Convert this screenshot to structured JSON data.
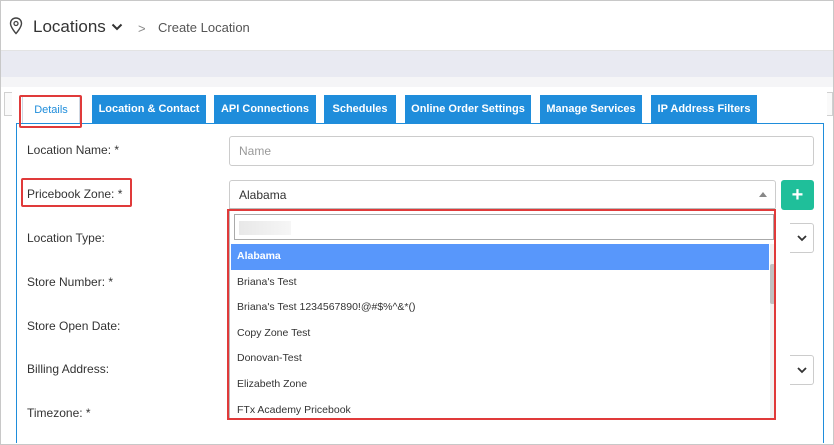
{
  "header": {
    "title": "Locations",
    "breadcrumb_separator": ">",
    "breadcrumb_current": "Create Location"
  },
  "tabs": [
    {
      "label": "Details",
      "active": true
    },
    {
      "label": "Location & Contact"
    },
    {
      "label": "API Connections"
    },
    {
      "label": "Schedules"
    },
    {
      "label": "Online Order Settings"
    },
    {
      "label": "Manage Services"
    },
    {
      "label": "IP Address Filters"
    }
  ],
  "form": {
    "location_name_label": "Location Name: *",
    "location_name_placeholder": "Name",
    "pricebook_zone_label": "Pricebook Zone: *",
    "pricebook_zone_value": "Alabama",
    "location_type_label": "Location Type:",
    "store_number_label": "Store Number: *",
    "store_open_date_label": "Store Open Date:",
    "billing_address_label": "Billing Address:",
    "timezone_label": "Timezone: *",
    "add_zone_symbol": "+"
  },
  "dropdown": {
    "search_value": "",
    "options": [
      {
        "label": "Alabama",
        "selected": true
      },
      {
        "label": "Briana's Test"
      },
      {
        "label": "Briana's Test 1234567890!@#$%^&*()"
      },
      {
        "label": "Copy Zone Test"
      },
      {
        "label": "Donovan-Test"
      },
      {
        "label": "Elizabeth Zone"
      },
      {
        "label": "FTx Academy Pricebook"
      }
    ]
  },
  "colors": {
    "tab_blue": "#1f8ddb",
    "add_button": "#1fbf9a",
    "highlight_red": "#e03a3a",
    "option_selected": "#5897fb"
  },
  "icons": [
    "location-pin-icon",
    "chevron-down-icon",
    "chevron-right-icon",
    "plus-icon",
    "caret-up-icon"
  ]
}
